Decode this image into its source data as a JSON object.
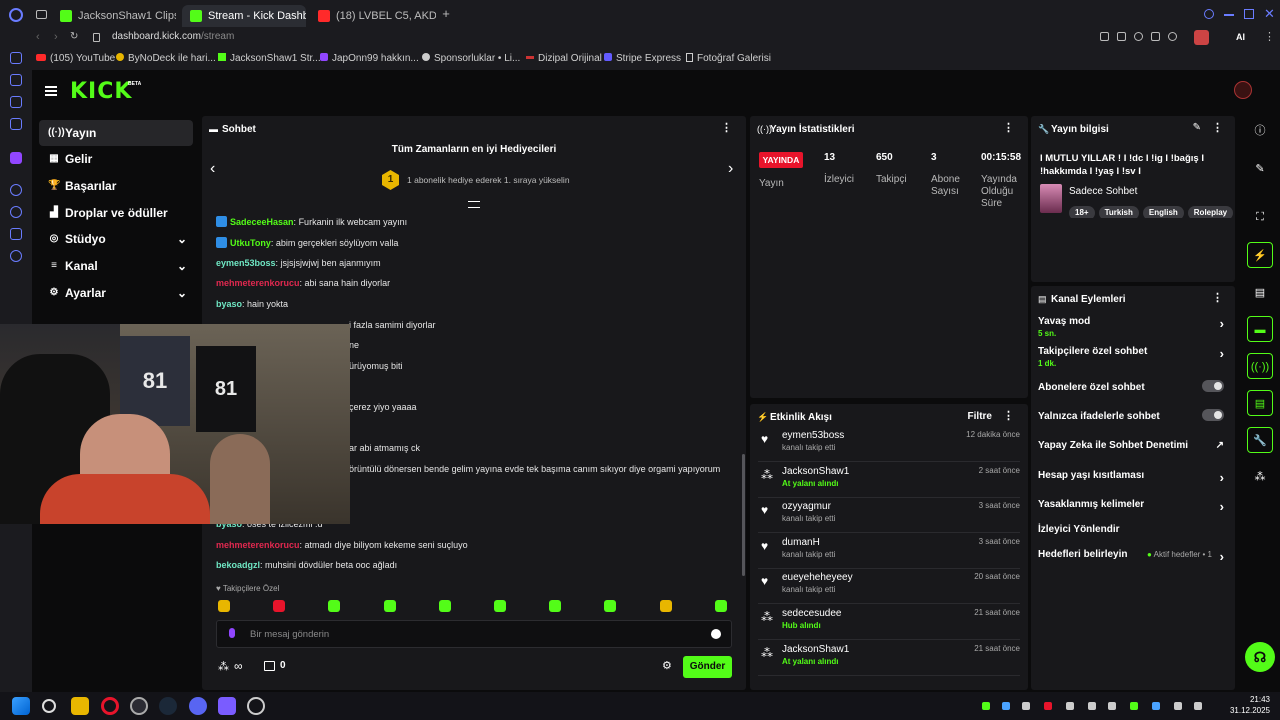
{
  "browser": {
    "tabs": [
      {
        "label": "JacksonShaw1 Clips - Wat",
        "color": "#53fc18"
      },
      {
        "label": "Stream - Kick Dashboard",
        "color": "#53fc18"
      },
      {
        "label": "(18) LVBEL C5, AKDO",
        "color": "#ff2a2a"
      }
    ],
    "url_host": "dashboard.kick.com",
    "url_path": "/stream",
    "bookmarks": [
      "(105) YouTube",
      "ByNoDeck ile hari...",
      "JacksonShaw1 Str...",
      "JapOnn99 hakkın...",
      "Sponsorluklar • Li...",
      "Dizipal Orijinal",
      "Stripe Express",
      "Fotoğraf Galerisi"
    ],
    "ai_label": "AI"
  },
  "app": {
    "logo": "KICK",
    "logo_badge": "BETA",
    "nav": [
      {
        "label": "Yayın",
        "icon": "((·))",
        "chevron": ""
      },
      {
        "label": "Gelir",
        "icon": "▦",
        "chevron": ""
      },
      {
        "label": "Başarılar",
        "icon": "🏆",
        "chevron": ""
      },
      {
        "label": "Droplar ve ödüller",
        "icon": "▟",
        "chevron": ""
      },
      {
        "label": "Stüdyo",
        "icon": "◎",
        "chevron": "⌄"
      },
      {
        "label": "Kanal",
        "icon": "≡",
        "chevron": "⌄"
      },
      {
        "label": "Ayarlar",
        "icon": "⚙",
        "chevron": "⌄"
      }
    ]
  },
  "chat": {
    "title": "Sohbet",
    "gifters_title": "Tüm Zamanların en iyi Hediyecileri",
    "gifters_rank": "1",
    "gifters_hint": "1 abonelik hediye ederek 1. sıraya yükselin",
    "messages": [
      {
        "user": "SadeceeHasan",
        "color": "#53fc18",
        "badge": true,
        "text": "Furkanin ilk webcam yayını"
      },
      {
        "user": "UtkuTony",
        "color": "#53fc18",
        "badge": true,
        "text": "abim gerçekleri söylüyom valla"
      },
      {
        "user": "eymen53boss",
        "color": "#6fe7c4",
        "badge": false,
        "text": "jsjsjsjwjwj ben ajanmıyım"
      },
      {
        "user": "mehmeterenkorucu",
        "color": "#e0284f",
        "badge": false,
        "text": "abi sana hain diyorlar"
      },
      {
        "user": "byaso",
        "color": "#6fe7c4",
        "badge": false,
        "text": "hain yokta"
      },
      {
        "user": "",
        "color": "#e0284f",
        "badge": false,
        "text": "i fazla samimi diyorlar"
      },
      {
        "user": "",
        "color": "#53fc18",
        "badge": false,
        "text": "ne"
      },
      {
        "user": "",
        "color": "#53fc18",
        "badge": false,
        "text": "ürüyomuş biti"
      },
      {
        "user": "",
        "color": "#53fc18",
        "badge": false,
        "text": "çerez yiyo yaaaa"
      },
      {
        "user": "",
        "color": "#53fc18",
        "badge": false,
        "text": "ar abi atmamış ck"
      },
      {
        "user": "",
        "color": "#53fc18",
        "badge": false,
        "text": "örüntülü dönersen bende gelim yayına evde tek başıma canım sıkıyor diye orgami yapıyorum"
      },
      {
        "user": "byaso",
        "color": "#6fe7c4",
        "badge": false,
        "text": "oses te izlicezmi :d"
      },
      {
        "user": "mehmeterenkorucu",
        "color": "#e0284f",
        "badge": false,
        "text": "atmadı diye biliyom kekeme seni suçluyo"
      },
      {
        "user": "bekoadgzl",
        "color": "#6fe7c4",
        "badge": false,
        "text": "muhsini dövdüler beta ooc ağladı"
      }
    ],
    "followers_only": "Takipçilere Özel",
    "input_placeholder": "Bir mesaj gönderin",
    "points": "∞",
    "store_count": "0",
    "send_label": "Gönder"
  },
  "stats": {
    "title": "Yayın İstatistikleri",
    "live_badge": "YAYINDA",
    "items": [
      {
        "value": "",
        "label": "Yayın"
      },
      {
        "value": "13",
        "label": "İzleyici"
      },
      {
        "value": "650",
        "label": "Takipçi"
      },
      {
        "value": "3",
        "label": "Abone Sayısı"
      },
      {
        "value": "00:15:58",
        "label": "Yayında Olduğu Süre"
      }
    ]
  },
  "info": {
    "title": "Yayın bilgisi",
    "stream_title": "I MUTLU YILLAR ! I !dc I !ig I !bağış I !hakkımda I !yaş I !sv I",
    "category": "Sadece Sohbet",
    "tags": [
      "18+",
      "Turkish",
      "English",
      "Roleplay"
    ]
  },
  "actions": {
    "title": "Kanal Eylemleri",
    "items": [
      {
        "label": "Yavaş mod",
        "sub": "5 sn.",
        "control": "arrow"
      },
      {
        "label": "Takipçilere özel sohbet",
        "sub": "1 dk.",
        "control": "arrow"
      },
      {
        "label": "Abonelere özel sohbet",
        "sub": "",
        "control": "toggle"
      },
      {
        "label": "Yalnızca ifadelerle sohbet",
        "sub": "",
        "control": "toggle"
      },
      {
        "label": "Yapay Zeka ile Sohbet Denetimi",
        "sub": "",
        "control": "external"
      },
      {
        "label": "Hesap yaşı kısıtlaması",
        "sub": "",
        "control": "arrow"
      },
      {
        "label": "Yasaklanmış kelimeler",
        "sub": "",
        "control": "arrow"
      },
      {
        "label": "İzleyici Yönlendir",
        "sub": "",
        "control": "none"
      },
      {
        "label": "Hedefleri belirleyin",
        "sub": "",
        "control": "goal",
        "extra": "Aktif hedefler • 1"
      }
    ]
  },
  "events": {
    "title": "Etkinlik Akışı",
    "filter_label": "Filtre",
    "items": [
      {
        "name": "eymen53boss",
        "sub": "kanalı takip etti",
        "time": "12 dakika önce",
        "green": false,
        "icon": "heart"
      },
      {
        "name": "JacksonShaw1",
        "sub": "At yalanı alındı",
        "time": "2 saat önce",
        "green": true,
        "icon": "gift"
      },
      {
        "name": "ozyyagmur",
        "sub": "kanalı takip etti",
        "time": "3 saat önce",
        "green": false,
        "icon": "heart"
      },
      {
        "name": "dumanH",
        "sub": "kanalı takip etti",
        "time": "3 saat önce",
        "green": false,
        "icon": "heart"
      },
      {
        "name": "eueyeheheyeey",
        "sub": "kanalı takip etti",
        "time": "20 saat önce",
        "green": false,
        "icon": "heart"
      },
      {
        "name": "sedecesudee",
        "sub": "Hub alındı",
        "time": "21 saat önce",
        "green": true,
        "icon": "gift"
      },
      {
        "name": "JacksonShaw1",
        "sub": "At yalanı alındı",
        "time": "21 saat önce",
        "green": true,
        "icon": "gift"
      }
    ]
  },
  "taskbar": {
    "time": "21:43",
    "date": "31.12.2025"
  },
  "colors": {
    "accent": "#53fc18",
    "live": "#e8142b",
    "panel": "#18181b"
  }
}
